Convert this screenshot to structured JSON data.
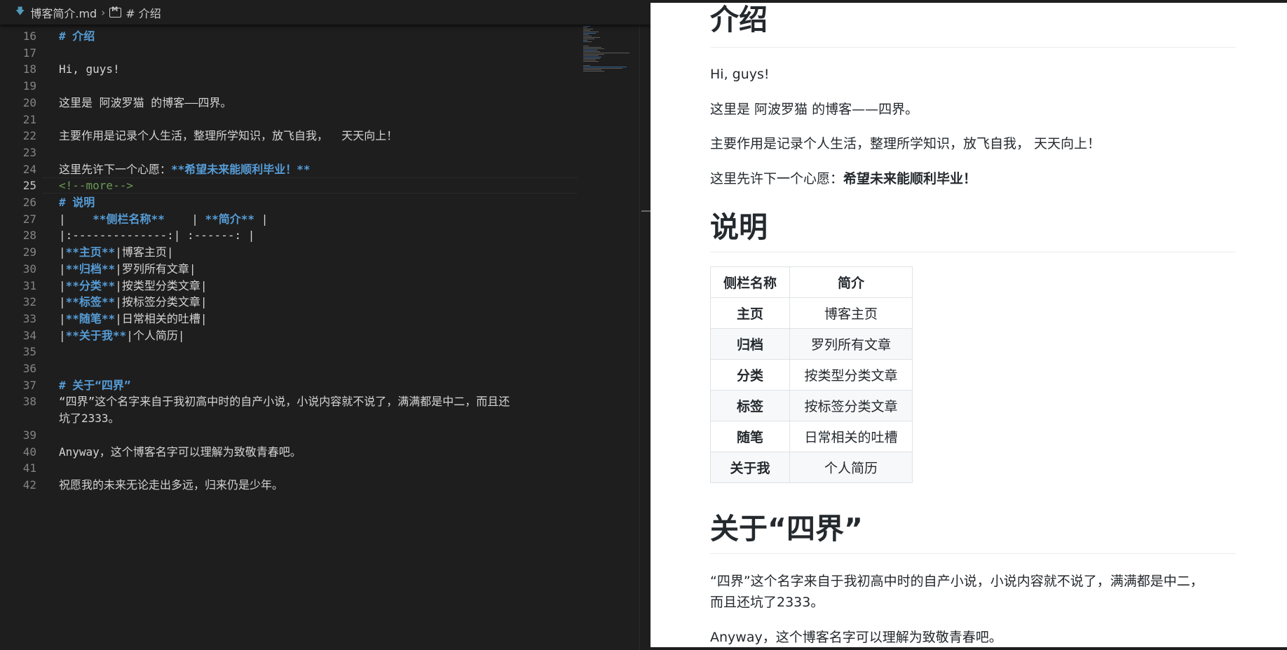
{
  "breadcrumb": {
    "file": "博客简介.md",
    "section": "# 介绍"
  },
  "editor": {
    "current_line": 25,
    "lines": [
      {
        "n": "16",
        "parts": [
          {
            "t": "# 介绍",
            "c": "heading"
          }
        ]
      },
      {
        "n": "17",
        "parts": []
      },
      {
        "n": "18",
        "parts": [
          {
            "t": "Hi, guys!",
            "c": ""
          }
        ]
      },
      {
        "n": "19",
        "parts": []
      },
      {
        "n": "20",
        "parts": [
          {
            "t": "这里是 阿波罗猫 的博客——四界。",
            "c": ""
          }
        ]
      },
      {
        "n": "21",
        "parts": []
      },
      {
        "n": "22",
        "parts": [
          {
            "t": "主要作用是记录个人生活，整理所学知识，放飞自我，  天天向上！",
            "c": ""
          }
        ]
      },
      {
        "n": "23",
        "parts": []
      },
      {
        "n": "24",
        "parts": [
          {
            "t": "这里先许下一个心愿：",
            "c": ""
          },
          {
            "t": "**希望未来能顺利毕业！**",
            "c": "bold"
          }
        ]
      },
      {
        "n": "25",
        "parts": [
          {
            "t": "<!--more-->",
            "c": "comment"
          }
        ]
      },
      {
        "n": "26",
        "parts": [
          {
            "t": "# 说明",
            "c": "heading"
          }
        ]
      },
      {
        "n": "27",
        "parts": [
          {
            "t": "|    ",
            "c": ""
          },
          {
            "t": "**侧栏名称**",
            "c": "bold"
          },
          {
            "t": "    | ",
            "c": ""
          },
          {
            "t": "**简介**",
            "c": "bold"
          },
          {
            "t": " |",
            "c": ""
          }
        ]
      },
      {
        "n": "28",
        "parts": [
          {
            "t": "|:--------------:| :------: |",
            "c": ""
          }
        ]
      },
      {
        "n": "29",
        "parts": [
          {
            "t": "|",
            "c": ""
          },
          {
            "t": "**主页**",
            "c": "bold"
          },
          {
            "t": "|博客主页|",
            "c": ""
          }
        ]
      },
      {
        "n": "30",
        "parts": [
          {
            "t": "|",
            "c": ""
          },
          {
            "t": "**归档**",
            "c": "bold"
          },
          {
            "t": "|罗列所有文章|",
            "c": ""
          }
        ]
      },
      {
        "n": "31",
        "parts": [
          {
            "t": "|",
            "c": ""
          },
          {
            "t": "**分类**",
            "c": "bold"
          },
          {
            "t": "|按类型分类文章|",
            "c": ""
          }
        ]
      },
      {
        "n": "32",
        "parts": [
          {
            "t": "|",
            "c": ""
          },
          {
            "t": "**标签**",
            "c": "bold"
          },
          {
            "t": "|按标签分类文章|",
            "c": ""
          }
        ]
      },
      {
        "n": "33",
        "parts": [
          {
            "t": "|",
            "c": ""
          },
          {
            "t": "**随笔**",
            "c": "bold"
          },
          {
            "t": "|日常相关的吐槽|",
            "c": ""
          }
        ]
      },
      {
        "n": "34",
        "parts": [
          {
            "t": "|",
            "c": ""
          },
          {
            "t": "**关于我**",
            "c": "bold"
          },
          {
            "t": "|个人简历|",
            "c": ""
          }
        ]
      },
      {
        "n": "35",
        "parts": []
      },
      {
        "n": "36",
        "parts": []
      },
      {
        "n": "37",
        "parts": [
          {
            "t": "# 关于“四界”",
            "c": "heading"
          }
        ]
      },
      {
        "n": "38",
        "parts": [
          {
            "t": "“四界”这个名字来自于我初高中时的自产小说，小说内容就不说了，满满都是中二，而且还",
            "c": ""
          }
        ]
      },
      {
        "n": "",
        "parts": [
          {
            "t": "坑了2333。",
            "c": ""
          }
        ]
      },
      {
        "n": "39",
        "parts": []
      },
      {
        "n": "40",
        "parts": [
          {
            "t": "Anyway，这个博客名字可以理解为致敬青春吧。",
            "c": ""
          }
        ]
      },
      {
        "n": "41",
        "parts": []
      },
      {
        "n": "42",
        "parts": [
          {
            "t": "祝愿我的未来无论走出多远，归来仍是少年。",
            "c": ""
          }
        ]
      }
    ]
  },
  "preview": {
    "h_intro": "介绍",
    "p_hi": "Hi, guys!",
    "p_blog": "这里是 阿波罗猫 的博客——四界。",
    "p_purpose": "主要作用是记录个人生活，整理所学知识，放飞自我，  天天向上！",
    "p_wish_prefix": "这里先许下一个心愿：",
    "p_wish_bold": "希望未来能顺利毕业！",
    "h_desc": "说明",
    "table": {
      "headers": [
        "侧栏名称",
        "简介"
      ],
      "rows": [
        [
          "主页",
          "博客主页"
        ],
        [
          "归档",
          "罗列所有文章"
        ],
        [
          "分类",
          "按类型分类文章"
        ],
        [
          "标签",
          "按标签分类文章"
        ],
        [
          "随笔",
          "日常相关的吐槽"
        ],
        [
          "关于我",
          "个人简历"
        ]
      ]
    },
    "h_about": "关于“四界”",
    "p_about_1": "“四界”这个名字来自于我初高中时的自产小说，小说内容就不说了，满满都是中二，",
    "p_about_2": "而且还坑了2333。",
    "p_anyway": "Anyway，这个博客名字可以理解为致敬青春吧。"
  },
  "icons": {
    "file_icon": "markdown-download-icon",
    "chevron": "chevron-right-icon",
    "section_icon": "markdown-section-icon"
  },
  "colors": {
    "editor_bg": "#1e1e1e",
    "heading": "#569cd6",
    "comment": "#6a9955",
    "text": "#d4d4d4"
  }
}
